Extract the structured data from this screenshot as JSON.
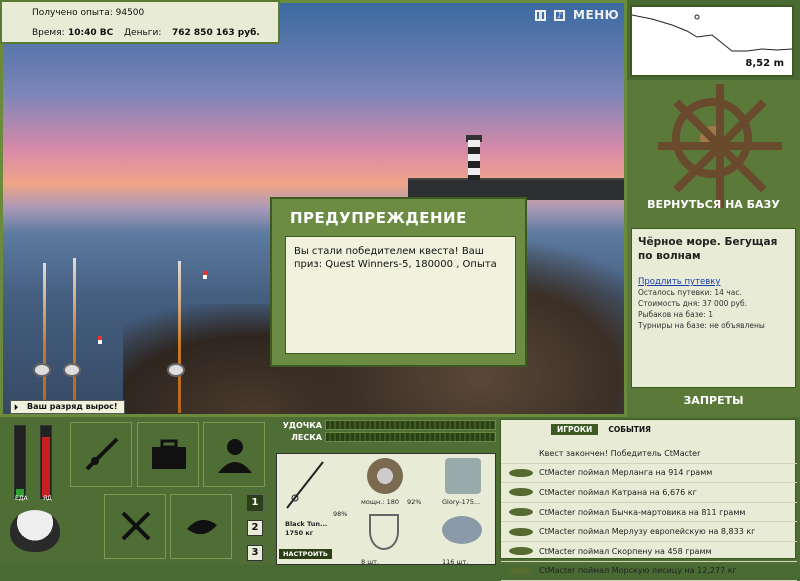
{
  "hud": {
    "xp_label": "Получено опыта:",
    "xp_value": "94500",
    "time_label": "Время:",
    "time_value": "10:40 ВС",
    "money_label": "Деньги:",
    "money_value": "762 850 163 руб."
  },
  "top_bar": {
    "menu_label": "МЕНЮ",
    "pause_icon": "pause-icon",
    "sound_icon": "sound-icon"
  },
  "depth": {
    "value": "8,52 m"
  },
  "dialog": {
    "title": "ПРЕДУПРЕЖДЕНИЕ",
    "message": "Вы стали победителем квеста! Ваш приз: Quest Winners-5, 180000 , Опыта"
  },
  "rank": {
    "text": "Ваш разряд вырос!"
  },
  "right_panel": {
    "return_label": "ВЕРНУТЬСЯ НА БАЗУ",
    "location_title": "Чёрное море. Бегущая по волнам",
    "extend_link": "Продлить путевку",
    "lines": [
      "Осталось путевки: 14 час.",
      "Стоимость дня: 37 000 руб.",
      "Рыбаков на базе: 1",
      "Турниры на базе: не объявлены"
    ],
    "bans_label": "ЗАПРЕТЫ"
  },
  "meters": {
    "food_label": "ЕДА",
    "poison_label": "ЯД",
    "food_level": 0.15,
    "poison_level": 0.85
  },
  "inventory": {
    "pages": [
      "1",
      "2",
      "3"
    ]
  },
  "gear": {
    "rod_label": "УДОЧКА",
    "line_label": "ЛЕСКА",
    "rod_name": "Black Tun...",
    "rod_weight": "1750 кг",
    "rod_pct": "98%",
    "reel_label": "мощн.: 180",
    "reel_pct": "92%",
    "lure_name": "Glory-175...",
    "hooks_count": "8 шт.",
    "bait_count": "116 шт.",
    "setup_label": "НАСТРОИТЬ"
  },
  "events": {
    "tabs": [
      "ИГРОКИ",
      "СОБЫТИЯ"
    ],
    "items": [
      "Квест закончен! Победитель CtMacter",
      "CtMacter поймал Мерланга на 914 грамм",
      "CtMacter поймал Катрана на 6,676 кг",
      "CtMacter поймал Бычка-мартовика на 811 грамм",
      "CtMacter поймал Мерлузу европейскую на 8,833 кг",
      "CtMacter поймал Скорпену на 458 грамм",
      "CtMacter поймал Морскую лисицу на 12,277 кг"
    ]
  }
}
